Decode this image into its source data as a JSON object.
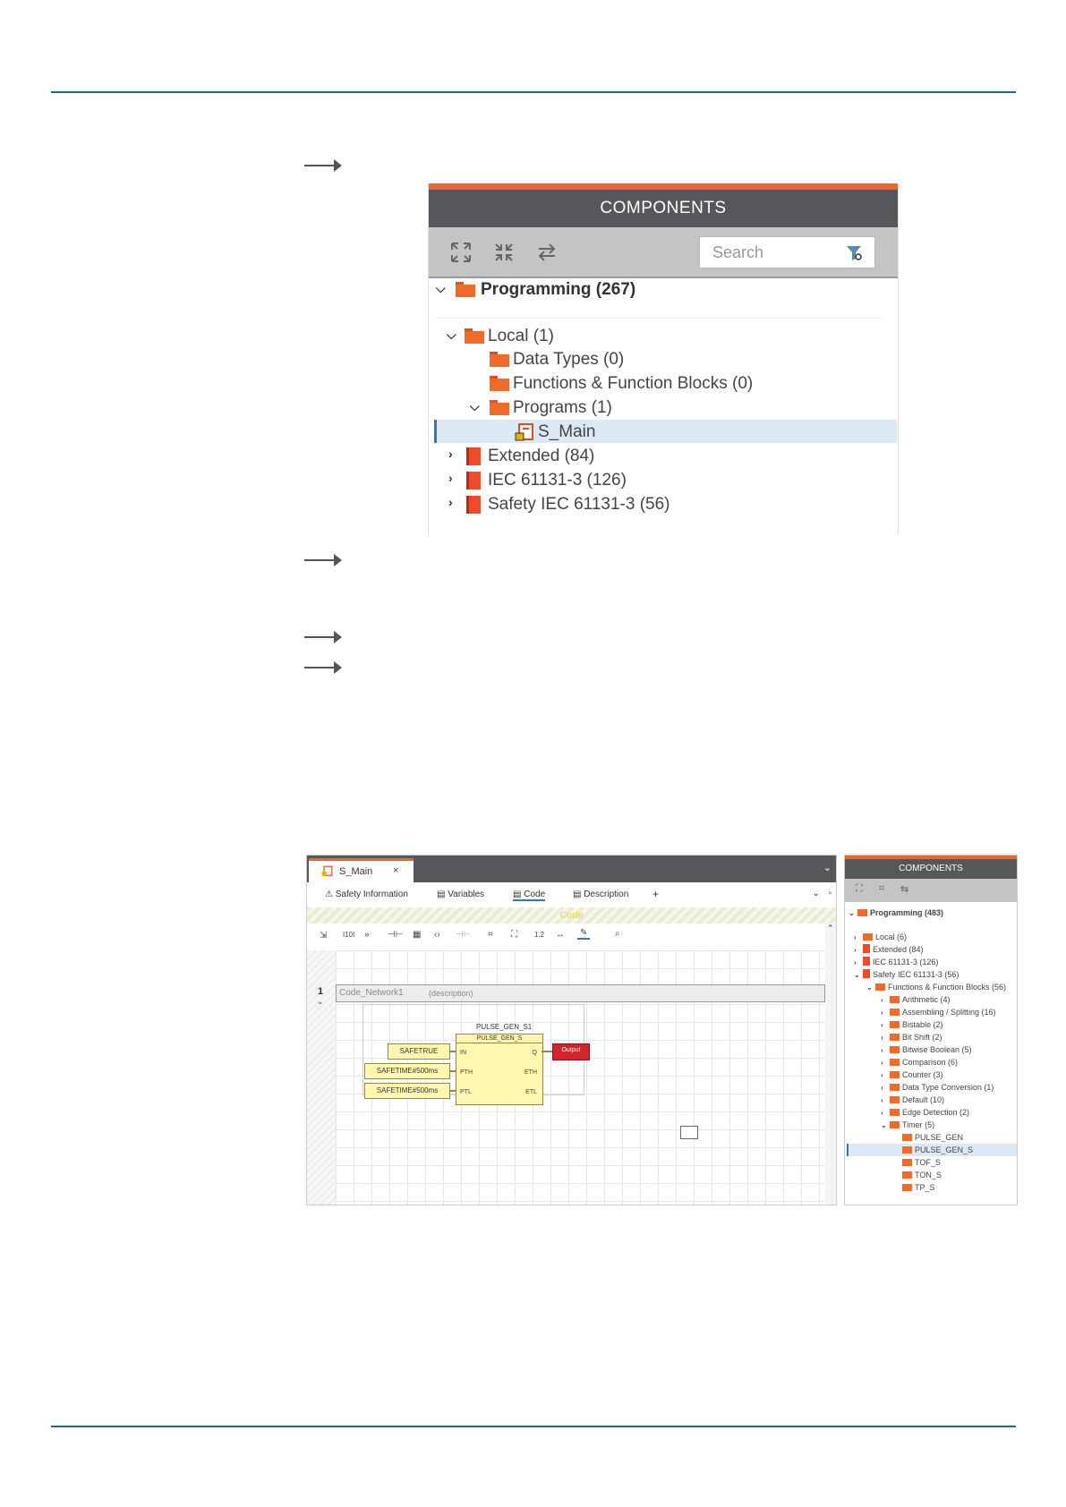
{
  "components_panel": {
    "header": "COMPONENTS",
    "search_placeholder": "Search",
    "programming": "Programming (267)",
    "local": "Local (1)",
    "data_types": "Data Types (0)",
    "functions": "Functions & Function Blocks (0)",
    "programs": "Programs (1)",
    "s_main": "S_Main",
    "extended": "Extended (84)",
    "iec": "IEC 61131-3 (126)",
    "safety_iec": "Safety IEC 61131-3 (56)"
  },
  "editor": {
    "tab_title": "S_Main",
    "close": "×",
    "sub_tabs": [
      "Safety Information",
      "Variables",
      "Code",
      "Description"
    ],
    "add": "+",
    "code_bar": "Code",
    "network_number": "1",
    "network_name": "Code_Network1",
    "network_description": "(description)",
    "block_instance": "PULSE_GEN_S1",
    "block_type": "PULSE_GEN_S",
    "inputs": [
      "SAFETRUE",
      "SAFETIME#500ms",
      "SAFETIME#500ms"
    ],
    "in_pins": [
      "IN",
      "PTH",
      "PTL"
    ],
    "out_pins": [
      "Q",
      "ETH",
      "ETL"
    ],
    "output": "Output",
    "toolbar_labels": [
      "I10I",
      "1.2"
    ]
  },
  "editor_components": {
    "header": "COMPONENTS",
    "programming": "Programming (483)",
    "items": [
      "Local (6)",
      "Extended (84)",
      "IEC 61131-3 (126)",
      "Safety IEC 61131-3 (56)",
      "Functions & Function Blocks (56)",
      "Arithmetic (4)",
      "Assembling / Splitting (16)",
      "Bistable (2)",
      "Bit Shift (2)",
      "Bitwise Boolean (5)",
      "Comparison (6)",
      "Counter (3)",
      "Data Type Conversion (1)",
      "Default (10)",
      "Edge Detection (2)",
      "Timer (5)",
      "PULSE_GEN",
      "PULSE_GEN_S",
      "TOF_S",
      "TON_S",
      "TP_S"
    ]
  }
}
